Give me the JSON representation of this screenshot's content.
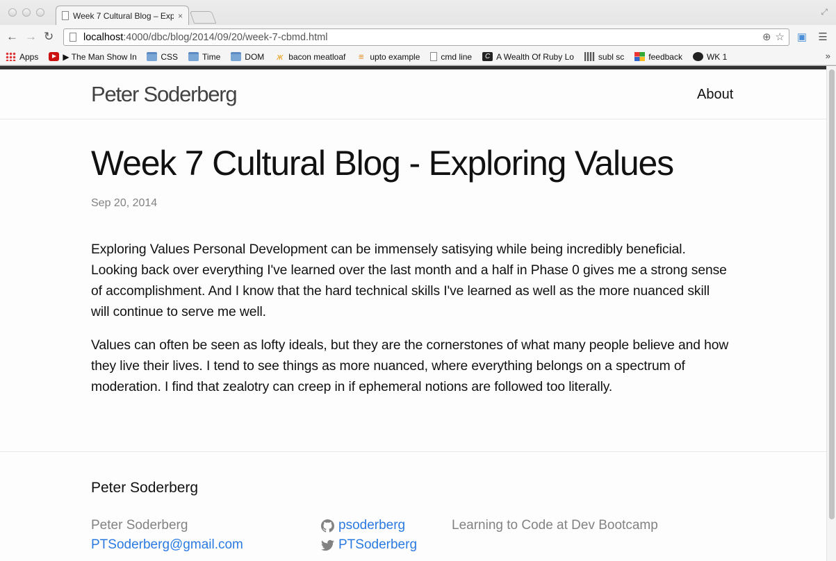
{
  "browser": {
    "tab_title": "Week 7 Cultural Blog – Exp",
    "tab_close": "×",
    "url_host": "localhost",
    "url_path": ":4000/dbc/blog/2014/09/20/week-7-cbmd.html",
    "nav": {
      "back": "←",
      "forward": "→",
      "reload": "↻"
    },
    "bookmarks": [
      {
        "label": "Apps",
        "icon": "apps-grid-icon"
      },
      {
        "label": "▶ The Man Show InT",
        "icon": "youtube-icon"
      },
      {
        "label": "CSS",
        "icon": "folder-icon"
      },
      {
        "label": "Time",
        "icon": "folder-icon"
      },
      {
        "label": "DOM",
        "icon": "folder-icon"
      },
      {
        "label": "bacon meatloaf",
        "icon": "butterfly-icon"
      },
      {
        "label": "upto example",
        "icon": "stackoverflow-icon"
      },
      {
        "label": "cmd line",
        "icon": "page-icon"
      },
      {
        "label": "A Wealth Of Ruby Lo",
        "icon": "ruby-icon"
      },
      {
        "label": "subl sc",
        "icon": "film-icon"
      },
      {
        "label": "feedback",
        "icon": "microsoft-icon"
      },
      {
        "label": "WK 1",
        "icon": "github-icon"
      }
    ],
    "bookmarks_overflow": "»"
  },
  "site": {
    "title": "Peter Soderberg",
    "nav_about": "About"
  },
  "post": {
    "title": "Week 7 Cultural Blog - Exploring Values",
    "date": "Sep 20, 2014",
    "paragraphs": [
      "Exploring Values Personal Development can be immensely satisying while being incredibly beneficial. Looking back over everything I've learned over the last month and a half in Phase 0 gives me a strong sense of accomplishment. And I know that the hard technical skills I've learned as well as the more nuanced skill will continue to serve me well.",
      "Values can often be seen as lofty ideals, but they are the cornerstones of what many people believe and how they live their lives. I tend to see things as more nuanced, where everything belongs on a spectrum of moderation. I find that zealotry can creep in if ephemeral notions are followed too literally."
    ]
  },
  "footer": {
    "heading": "Peter Soderberg",
    "name": "Peter Soderberg",
    "email": "PTSoderberg@gmail.com",
    "github_user": "psoderberg",
    "twitter_user": "PTSoderberg",
    "description": "Learning to Code at Dev Bootcamp"
  },
  "colors": {
    "link": "#2a7ae2",
    "muted": "#828282",
    "text": "#111111",
    "top_bar": "#333333"
  }
}
